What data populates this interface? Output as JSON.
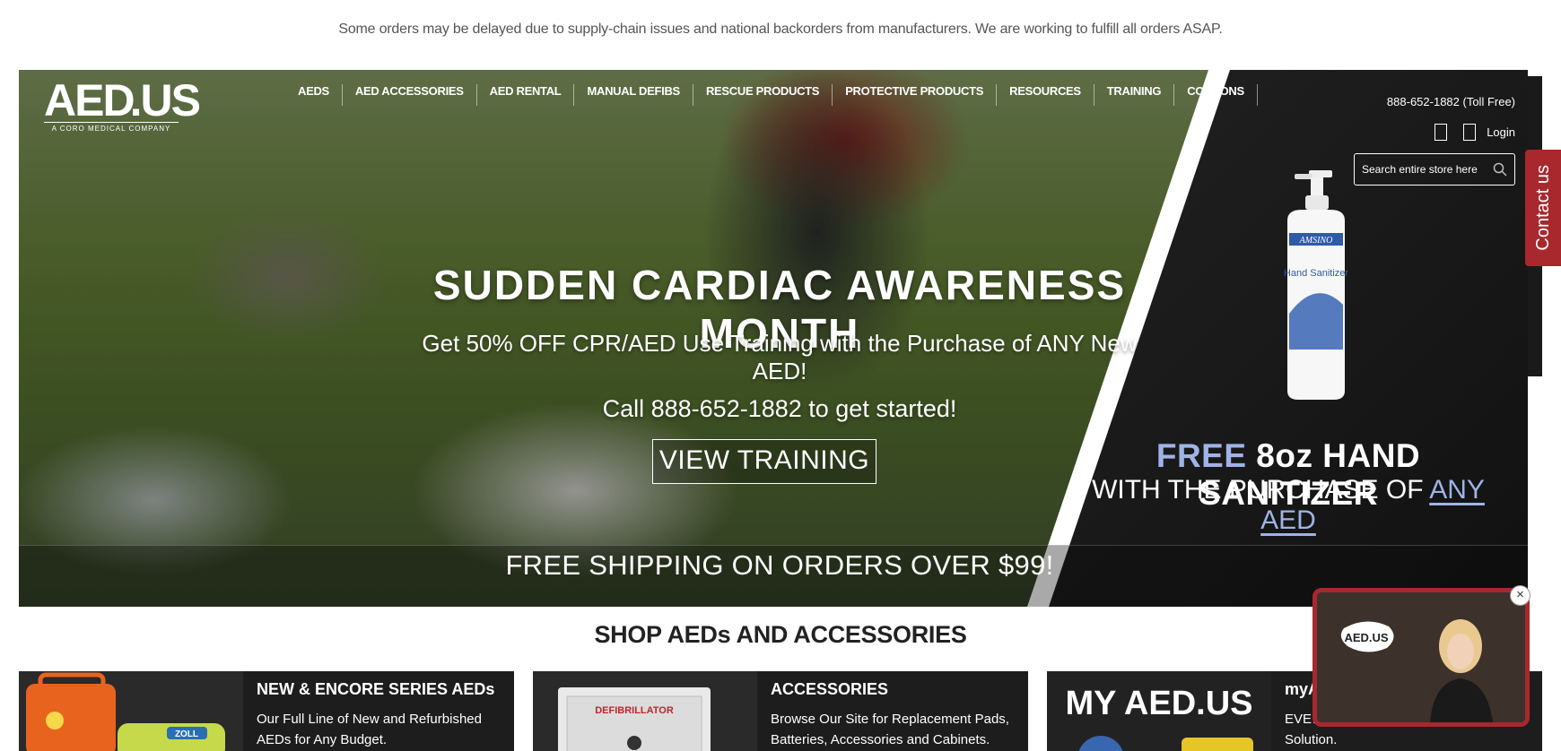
{
  "notice": "Some orders may be delayed due to supply-chain issues and national backorders from manufacturers. We are working to fulfill all orders ASAP.",
  "logo": {
    "text_left": "AED",
    "text_right": ".US",
    "tagline": "A CORO MEDICAL COMPANY"
  },
  "nav": [
    "AEDS",
    "AED ACCESSORIES",
    "AED RENTAL",
    "MANUAL DEFIBS",
    "RESCUE PRODUCTS",
    "PROTECTIVE PRODUCTS",
    "RESOURCES",
    "TRAINING",
    "COUPONS"
  ],
  "header": {
    "phone": "888-652-1882 (Toll Free)",
    "login": "Login",
    "search_placeholder": "Search entire store here"
  },
  "hero": {
    "headline": "SUDDEN CARDIAC AWARENESS MONTH",
    "subhead": "Get 50% OFF CPR/AED Use Training with the Purchase of ANY New AED!",
    "callout": "Call 888-652-1882 to get started!",
    "button": "VIEW TRAINING",
    "shipping": "FREE SHIPPING ON ORDERS OVER $99!"
  },
  "promo": {
    "line1_a": "FREE",
    "line1_b": " 8oz HAND SANITIZER",
    "line2_a": "WITH THE PURCHASE OF ",
    "line2_b": "ANY AED",
    "bottle_brand": "AMSINO",
    "bottle_label": "Hand Sanitizer"
  },
  "contact": "Contact us",
  "section_title": "SHOP AEDs AND ACCESSORIES",
  "cards": [
    {
      "title": "NEW & ENCORE SERIES AEDs",
      "desc": "Our Full Line of New and Refurbished AEDs for Any Budget.",
      "img_label": "ZOLL"
    },
    {
      "title": "ACCESSORIES",
      "desc": "Browse Our Site for Replacement Pads, Batteries, Accessories and Cabinets.",
      "img_label": "DEFIBRILLATOR"
    },
    {
      "title": "myAE",
      "desc": "EVE… Can Provide Your Total AED Solution.",
      "img_label": "MY AED.US"
    }
  ],
  "video": {
    "close": "×",
    "logo": "AED.US"
  },
  "colors": {
    "brand_red": "#a8282e",
    "accent_blue": "#9fb3e6",
    "dark": "#1d1d1d"
  }
}
